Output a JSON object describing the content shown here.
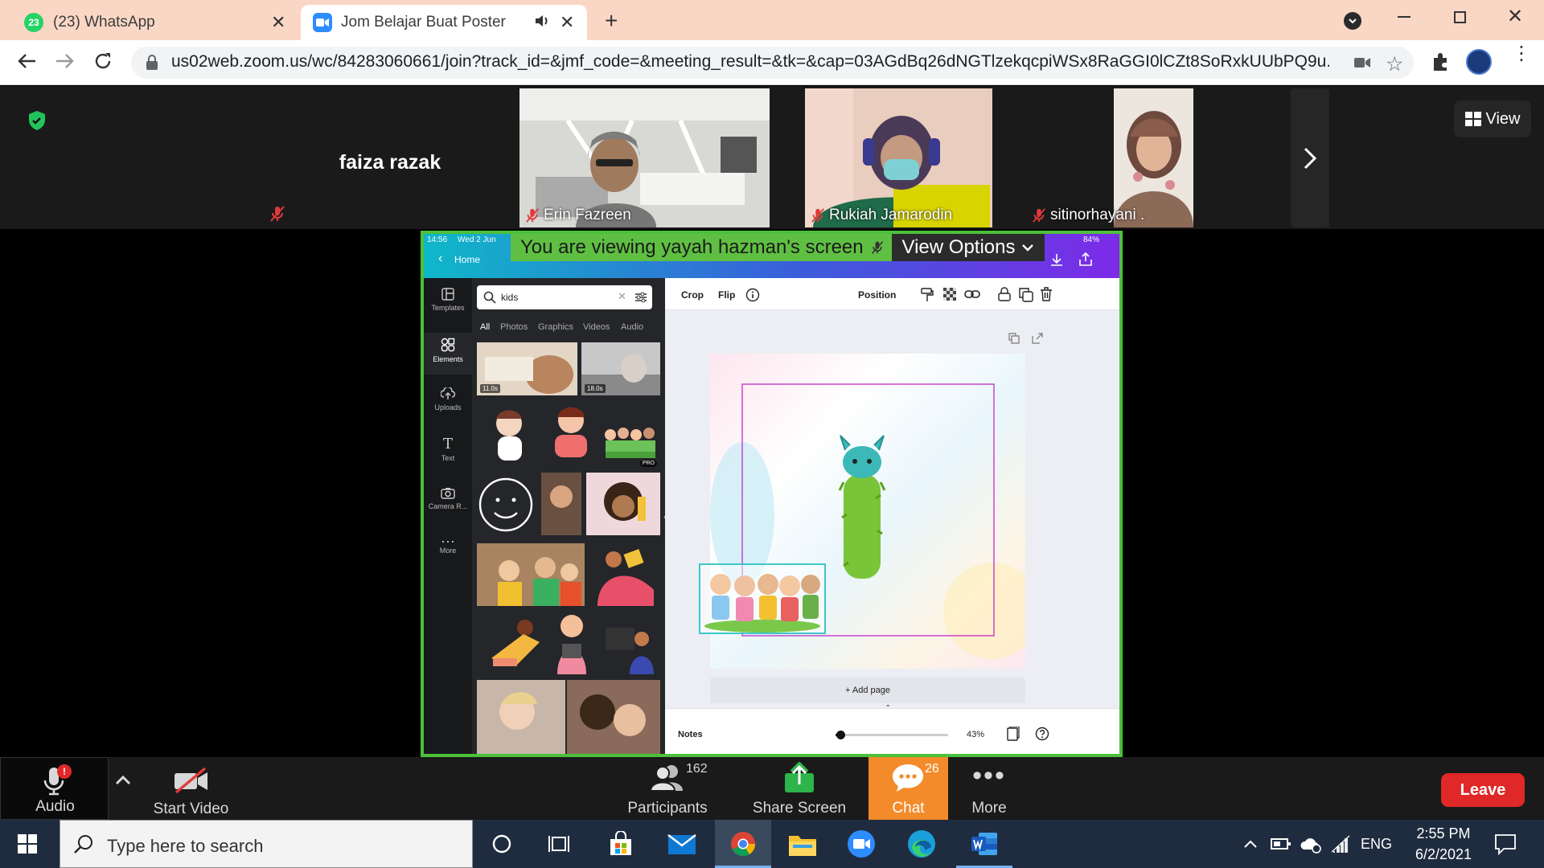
{
  "browser": {
    "tabs": [
      {
        "badge": "23",
        "title": "(23) WhatsApp",
        "active": false
      },
      {
        "title": "Jom Belajar Buat Poster",
        "active": true
      }
    ],
    "url": "us02web.zoom.us/wc/84283060661/join?track_id=&jmf_code=&meeting_result=&tk=&cap=03AGdBq26dNGTlzekqcpiWSx8RaGGI0lCZt8SoRxkUUbPQ9u..."
  },
  "zoom": {
    "participants": [
      {
        "name": "faiza razak",
        "muted": true
      },
      {
        "name": "Erin Fazreen",
        "muted": true
      },
      {
        "name": "Rukiah Jamarodin",
        "muted": true
      },
      {
        "name": "sitinorhayani .",
        "muted": true
      }
    ],
    "view_label": "View",
    "banner": "You are viewing yayah hazman's screen",
    "view_options": "View Options",
    "controls": {
      "audio": "Audio",
      "audio_badge": "!",
      "start_video": "Start Video",
      "participants": "Participants",
      "participants_count": "162",
      "share_screen": "Share Screen",
      "chat": "Chat",
      "chat_count": "26",
      "more": "More",
      "leave": "Leave"
    }
  },
  "canva": {
    "status_time": "14:56",
    "status_date": "Wed 2 Jun",
    "battery": "84%",
    "home": "Home",
    "sidebar": [
      {
        "label": "Templates",
        "icon": "templates-icon"
      },
      {
        "label": "Elements",
        "icon": "elements-icon"
      },
      {
        "label": "Uploads",
        "icon": "uploads-icon"
      },
      {
        "label": "Text",
        "icon": "text-icon"
      },
      {
        "label": "Camera R...",
        "icon": "camera-icon"
      },
      {
        "label": "More",
        "icon": "more-icon"
      }
    ],
    "search_value": "kids",
    "filter_tabs": [
      "All",
      "Photos",
      "Graphics",
      "Videos",
      "Audio"
    ],
    "video_durations": [
      "11.0s",
      "18.0s"
    ],
    "pro_badge": "PRO",
    "toolbar": {
      "crop": "Crop",
      "flip": "Flip",
      "position": "Position"
    },
    "add_page": "+ Add page",
    "notes": "Notes",
    "zoom_level": "43%",
    "zoom_slider_fraction": 0.04
  },
  "taskbar": {
    "search_placeholder": "Type here to search",
    "language": "ENG",
    "time": "2:55 PM",
    "date": "6/2/2021"
  },
  "colors": {
    "share_border": "#4cc03a",
    "chat_active": "#f38b2a",
    "leave": "#e02828",
    "canva_header_left": "#0fb8c9",
    "canva_header_right": "#7d2ae8"
  }
}
